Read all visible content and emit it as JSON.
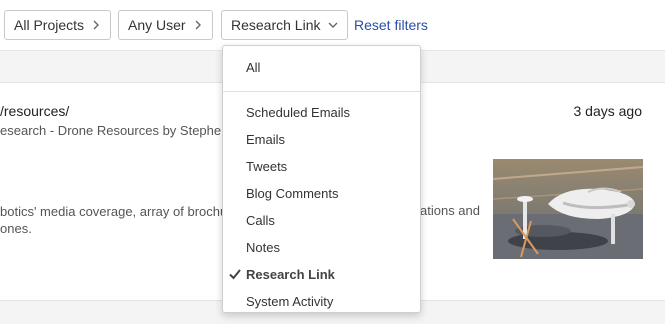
{
  "filters": {
    "projects_label": "All Projects",
    "user_label": "Any User",
    "type_label": "Research Link",
    "reset_label": "Reset filters"
  },
  "record": {
    "url": "/resources/",
    "subtitle": "esearch - Drone Resources by Stephen",
    "time": "3 days ago",
    "description_line1": "botics' media coverage, array of brochu",
    "description_line1_tail": "ations and",
    "description_line2": "ones."
  },
  "dropdown": {
    "items": [
      {
        "label": "All"
      },
      {
        "label": "Scheduled Emails"
      },
      {
        "label": "Emails"
      },
      {
        "label": "Tweets"
      },
      {
        "label": "Blog Comments"
      },
      {
        "label": "Calls"
      },
      {
        "label": "Notes"
      },
      {
        "label": "Research Link",
        "selected": true
      },
      {
        "label": "System Activity"
      }
    ]
  },
  "icons": {
    "projects_arrow": "chevron-right-icon",
    "user_arrow": "chevron-right-icon",
    "type_arrow": "chevron-down-icon",
    "selected_mark": "check-icon"
  },
  "colors": {
    "link": "#2a4fa3",
    "band": "#f4f4f4"
  }
}
